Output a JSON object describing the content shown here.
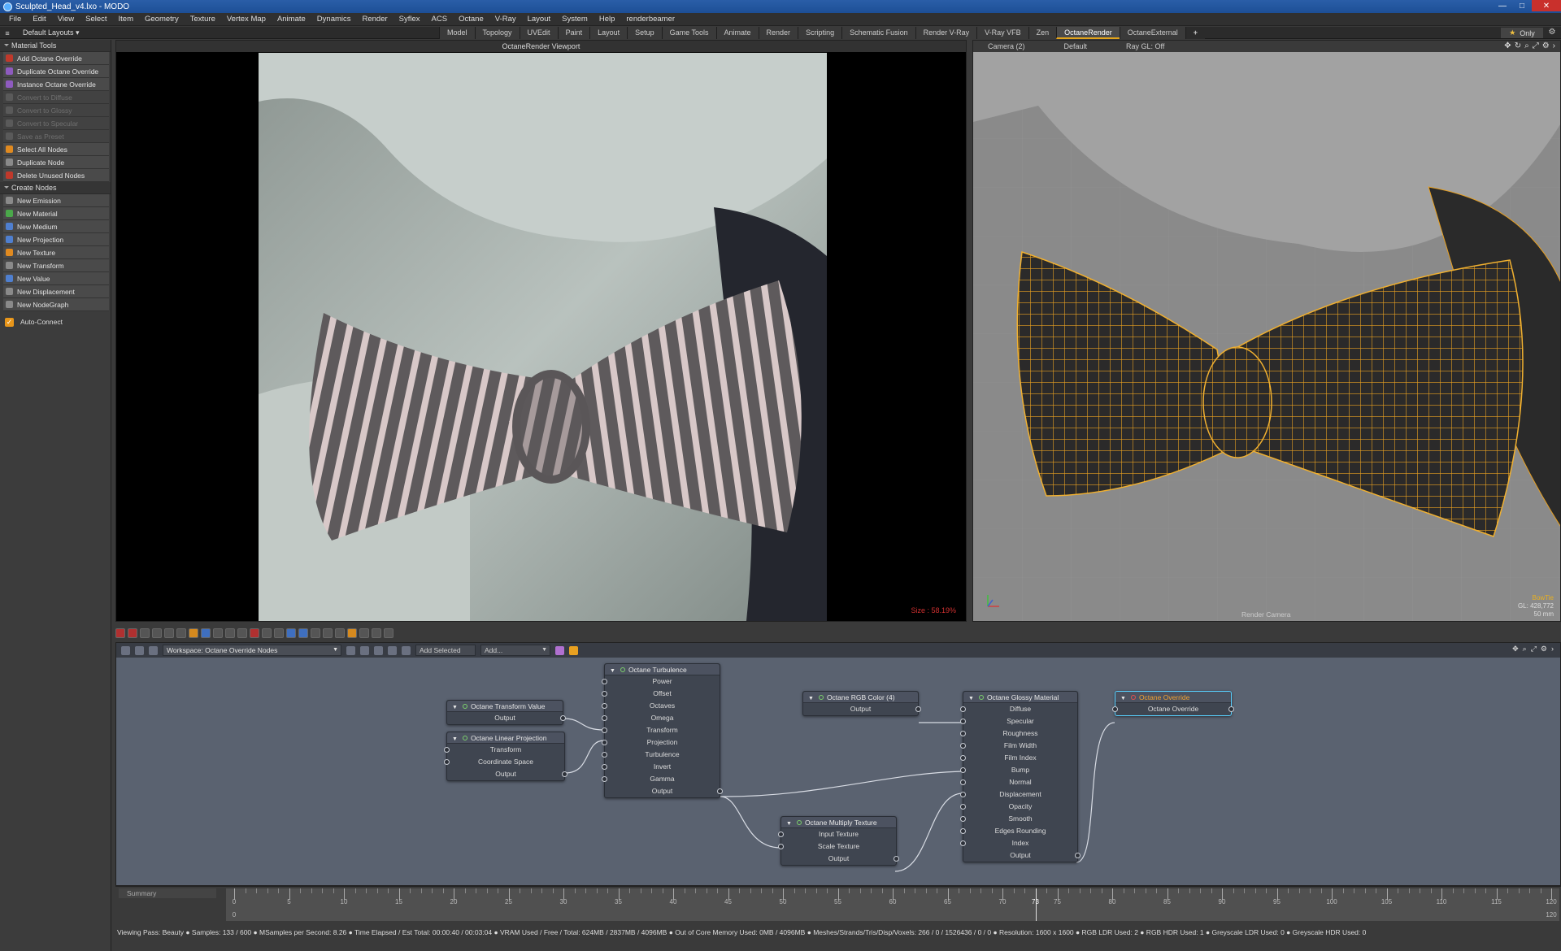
{
  "titlebar": {
    "title": "Sculpted_Head_v4.lxo - MODO",
    "controls": [
      "—",
      "□",
      "✕"
    ]
  },
  "menu": [
    "File",
    "Edit",
    "View",
    "Select",
    "Item",
    "Geometry",
    "Texture",
    "Vertex Map",
    "Animate",
    "Dynamics",
    "Render",
    "Syflex",
    "ACS",
    "Octane",
    "V-Ray",
    "Layout",
    "System",
    "Help",
    "renderbeamer"
  ],
  "layout_select": "Default Layouts ▾",
  "tabs": [
    "Model",
    "Topology",
    "UVEdit",
    "Paint",
    "Layout",
    "Setup",
    "Game Tools",
    "Animate",
    "Render",
    "Scripting",
    "Schematic Fusion",
    "Render V-Ray",
    "V-Ray VFB",
    "Zen",
    "OctaneRender",
    "OctaneExternal",
    "+"
  ],
  "active_tab": "OctaneRender",
  "only_label": "Only",
  "left_panel": {
    "material_tools_title": "Material Tools",
    "material_tools": [
      {
        "label": "Add Octane Override",
        "icon": "red",
        "enabled": true
      },
      {
        "label": "Duplicate Octane Override",
        "icon": "purple",
        "enabled": true
      },
      {
        "label": "Instance Octane Override",
        "icon": "purple",
        "enabled": true
      },
      {
        "label": "Convert to Diffuse",
        "icon": "gray",
        "enabled": false
      },
      {
        "label": "Convert to Glossy",
        "icon": "gray",
        "enabled": false
      },
      {
        "label": "Convert to Specular",
        "icon": "gray",
        "enabled": false
      },
      {
        "label": "Save as Preset",
        "icon": "gray",
        "enabled": false
      },
      {
        "label": "Select All Nodes",
        "icon": "orange",
        "enabled": true
      },
      {
        "label": "Duplicate Node",
        "icon": "gray",
        "enabled": true
      },
      {
        "label": "Delete Unused Nodes",
        "icon": "red",
        "enabled": true
      }
    ],
    "create_nodes_title": "Create Nodes",
    "create_nodes": [
      {
        "label": "New Emission",
        "icon": "gray"
      },
      {
        "label": "New Material",
        "icon": "green"
      },
      {
        "label": "New Medium",
        "icon": "blue"
      },
      {
        "label": "New Projection",
        "icon": "blue"
      },
      {
        "label": "New Texture",
        "icon": "orange"
      },
      {
        "label": "New Transform",
        "icon": "gray"
      },
      {
        "label": "New Value",
        "icon": "blue"
      },
      {
        "label": "New Displacement",
        "icon": "gray"
      },
      {
        "label": "New NodeGraph",
        "icon": "gray"
      }
    ],
    "auto_connect": "Auto-Connect"
  },
  "viewport_left": {
    "title": "OctaneRender Viewport",
    "size_text": "Size : 58.19%"
  },
  "viewport_right": {
    "camera": "Camera (2)",
    "shading": "Default",
    "raygl": "Ray GL: Off",
    "render_camera": "Render Camera",
    "object": "BowTie",
    "gl": "GL: 428,772",
    "focal": "50 mm"
  },
  "node_editor": {
    "workspace": "Workspace: Octane Override Nodes",
    "add_selected": "Add Selected",
    "add_menu": "Add...",
    "nodes": {
      "transform_value": {
        "title": "Octane Transform Value",
        "rows": [
          "Output"
        ]
      },
      "linear_projection": {
        "title": "Octane Linear Projection",
        "rows": [
          "Transform",
          "Coordinate Space",
          "Output"
        ]
      },
      "turbulence": {
        "title": "Octane Turbulence",
        "rows": [
          "Power",
          "Offset",
          "Octaves",
          "Omega",
          "Transform",
          "Projection",
          "Turbulence",
          "Invert",
          "Gamma",
          "Output"
        ]
      },
      "rgb_color": {
        "title": "Octane RGB Color (4)",
        "rows": [
          "Output"
        ]
      },
      "multiply_texture": {
        "title": "Octane Multiply Texture",
        "rows": [
          "Input Texture",
          "Scale Texture",
          "Output"
        ]
      },
      "glossy_material": {
        "title": "Octane Glossy Material",
        "rows": [
          "Diffuse",
          "Specular",
          "Roughness",
          "Film Width",
          "Film Index",
          "Bump",
          "Normal",
          "Displacement",
          "Opacity",
          "Smooth",
          "Edges Rounding",
          "Index",
          "Output"
        ]
      },
      "override": {
        "title": "Octane Override",
        "rows": [
          "Octane Override"
        ]
      }
    }
  },
  "timeline": {
    "summary": "Summary",
    "labels": [
      "0",
      "5",
      "10",
      "15",
      "20",
      "25",
      "30",
      "35",
      "40",
      "45",
      "50",
      "55",
      "60",
      "65",
      "70",
      "75",
      "80",
      "85",
      "90",
      "95",
      "100",
      "105",
      "110",
      "115",
      "120"
    ],
    "current": "73",
    "end_labels": [
      "0",
      "120"
    ]
  },
  "status_bar": "Viewing Pass: Beauty ● Samples: 133 / 600 ● MSamples per Second: 8.26 ● Time Elapsed / Est Total: 00:00:40 / 00:03:04 ● VRAM Used / Free / Total: 624MB / 2837MB / 4096MB ● Out of Core Memory Used: 0MB / 4096MB ● Meshes/Strands/Tris/Disp/Voxels: 266 / 0 / 1526436 / 0 / 0 ● Resolution: 1600 x 1600 ● RGB LDR Used: 2 ● RGB HDR Used: 1 ● Greyscale LDR Used: 0 ● Greyscale HDR Used: 0",
  "colors": {
    "accent": "#e3a41b",
    "node_bg": "#5a6270",
    "selected_node": "#58d0ff",
    "wire_orange": "#e8a020"
  }
}
